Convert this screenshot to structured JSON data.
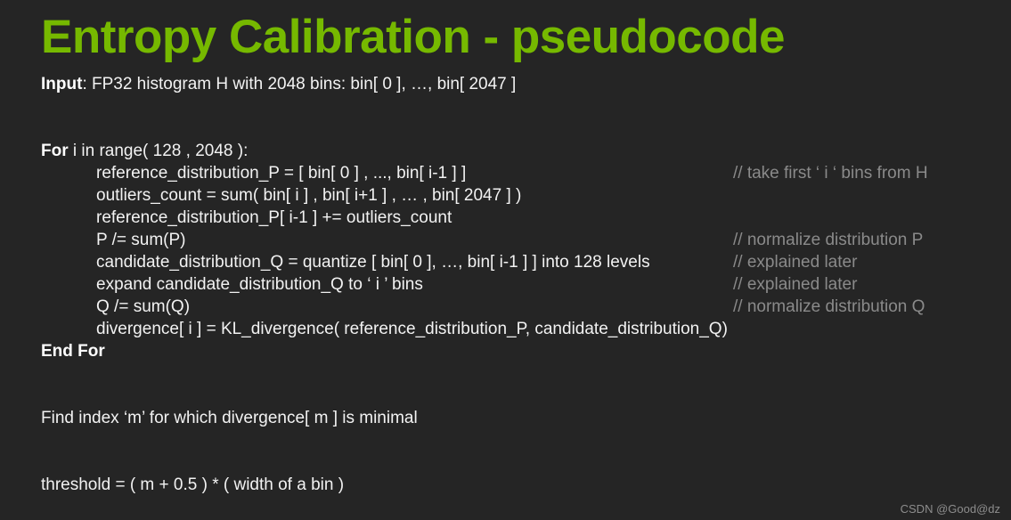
{
  "slide": {
    "title": "Entropy Calibration - pseudocode",
    "title_color": "#76b900",
    "background_color": "#252525",
    "text_color": "#f2f2f2",
    "comment_color": "#8a8a8a"
  },
  "input_line": {
    "keyword": "Input",
    "rest": ": FP32 histogram H with 2048 bins: bin[ 0 ], …, bin[ 2047 ]"
  },
  "for_line": {
    "keyword": "For",
    "rest": " i in range( 128 , 2048 ):"
  },
  "body": [
    {
      "code": "reference_distribution_P = [ bin[ 0 ] , ..., bin[ i-1 ] ]",
      "comment": "// take first ‘ i ‘ bins from H"
    },
    {
      "code": "outliers_count = sum( bin[ i ] , bin[ i+1 ] , … , bin[ 2047 ] )",
      "comment": ""
    },
    {
      "code": "reference_distribution_P[ i-1 ] += outliers_count",
      "comment": ""
    },
    {
      "code": "P /= sum(P)",
      "comment": "// normalize distribution P"
    },
    {
      "code": "candidate_distribution_Q = quantize [ bin[ 0 ], …, bin[ i-1 ] ] into 128 levels",
      "comment": "// explained later"
    },
    {
      "code": "expand candidate_distribution_Q to ‘ i ’ bins",
      "comment": "// explained later"
    },
    {
      "code": "Q /= sum(Q)",
      "comment": "// normalize distribution Q"
    },
    {
      "code": "divergence[ i ] = KL_divergence( reference_distribution_P,  candidate_distribution_Q)",
      "comment": ""
    }
  ],
  "end_for_line": "End For",
  "find_index_line": "Find index ‘m’ for which divergence[ m ] is minimal",
  "threshold_line": "threshold = ( m + 0.5 ) * ( width of a bin )",
  "watermark": "CSDN @Good@dz"
}
